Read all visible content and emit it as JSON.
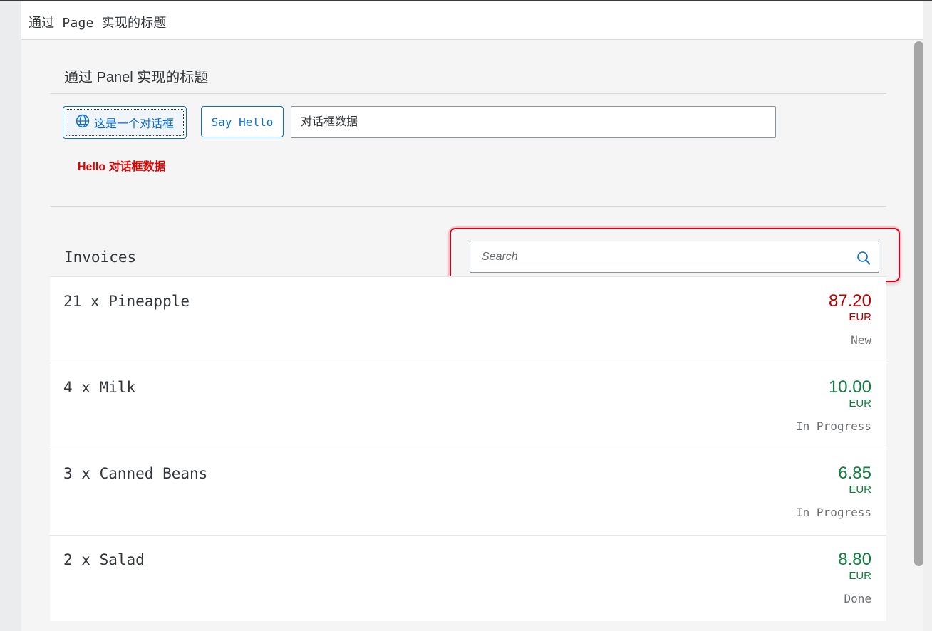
{
  "page": {
    "title": "通过 Page 实现的标题"
  },
  "panel": {
    "title": "通过 Panel 实现的标题",
    "dialog_button_label": "这是一个对话框",
    "hello_button_label": "Say Hello",
    "input_value": "对话框数据",
    "hello_message": "Hello 对话框数据"
  },
  "invoices": {
    "title": "Invoices",
    "search_placeholder": "Search",
    "items": [
      {
        "name": "21 x Pineapple",
        "amount": "87.20",
        "currency": "EUR",
        "status": "New",
        "amount_color": "#bb0000"
      },
      {
        "name": "4 x Milk",
        "amount": "10.00",
        "currency": "EUR",
        "status": "In Progress",
        "amount_color": "#107e3e"
      },
      {
        "name": "3 x Canned Beans",
        "amount": "6.85",
        "currency": "EUR",
        "status": "In Progress",
        "amount_color": "#107e3e"
      },
      {
        "name": "2 x Salad",
        "amount": "8.80",
        "currency": "EUR",
        "status": "Done",
        "amount_color": "#107e3e"
      }
    ]
  },
  "icons": {
    "dialog_button_icon": "globe-icon",
    "search_icon": "search-icon"
  },
  "colors": {
    "accent": "#0a6ed1",
    "error_text": "#e00000",
    "highlight_border": "#d0021b"
  }
}
